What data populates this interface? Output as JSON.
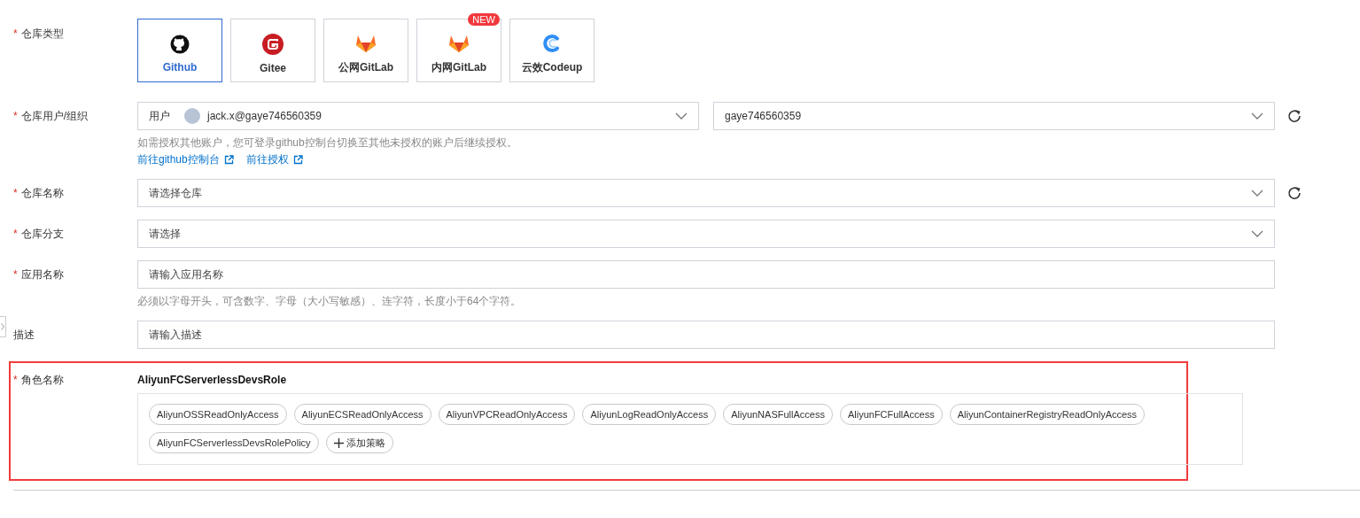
{
  "side_handle": true,
  "fields": [
    {
      "kind": "repo_type",
      "required_mark": "*",
      "label": "仓库类型",
      "options": [
        {
          "kind": "github",
          "label": "Github",
          "selected": true
        },
        {
          "kind": "gitee",
          "label": "Gitee",
          "selected": false
        },
        {
          "kind": "gitlab",
          "label": "公网GitLab",
          "selected": false
        },
        {
          "kind": "gitlab",
          "label": "内网GitLab",
          "selected": false,
          "badge": "NEW"
        },
        {
          "kind": "codeup",
          "label": "云效Codeup",
          "selected": false
        }
      ]
    },
    {
      "kind": "select_pair",
      "required_mark": "*",
      "label": "仓库用户/组织",
      "selects": [
        {
          "prefix": "用户",
          "avatar": true,
          "value": "jack.x@gaye746560359"
        },
        {
          "value": "gaye746560359"
        }
      ],
      "refresh": true,
      "hint": "如需授权其他账户，您可登录github控制台切换至其他未授权的账户后继续授权。",
      "links": [
        "前往github控制台",
        "前往授权"
      ]
    },
    {
      "kind": "select",
      "required_mark": "*",
      "label": "仓库名称",
      "placeholder": "请选择仓库",
      "refresh": true
    },
    {
      "kind": "select",
      "required_mark": "*",
      "label": "仓库分支",
      "placeholder": "请选择"
    },
    {
      "kind": "input",
      "required_mark": "*",
      "label": "应用名称",
      "placeholder": "请输入应用名称",
      "hint": "必须以字母开头，可含数字、字母（大小写敏感）、连字符，长度小于64个字符。"
    },
    {
      "kind": "input",
      "label": "描述",
      "placeholder": "请输入描述"
    },
    {
      "kind": "role",
      "required_mark": "*",
      "label": "角色名称",
      "highlighted": true,
      "role_name": "AliyunFCServerlessDevsRole",
      "policies": [
        "AliyunOSSReadOnlyAccess",
        "AliyunECSReadOnlyAccess",
        "AliyunVPCReadOnlyAccess",
        "AliyunLogReadOnlyAccess",
        "AliyunNASFullAccess",
        "AliyunFCFullAccess",
        "AliyunContainerRegistryReadOnlyAccess",
        "AliyunFCServerlessDevsRolePolicy"
      ],
      "add_label": "添加策略"
    }
  ]
}
